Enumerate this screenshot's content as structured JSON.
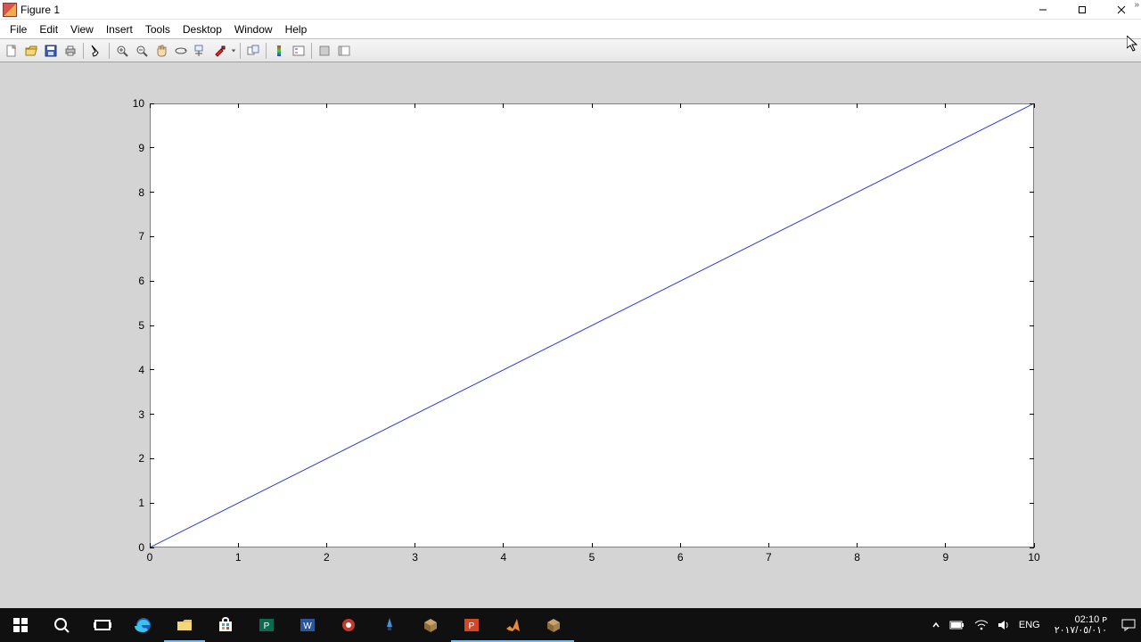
{
  "window": {
    "title": "Figure 1"
  },
  "menus": [
    "File",
    "Edit",
    "View",
    "Insert",
    "Tools",
    "Desktop",
    "Window",
    "Help"
  ],
  "chart_data": {
    "type": "line",
    "x": [
      0,
      1,
      2,
      3,
      4,
      5,
      6,
      7,
      8,
      9,
      10
    ],
    "y": [
      0,
      1,
      2,
      3,
      4,
      5,
      6,
      7,
      8,
      9,
      10
    ],
    "xlim": [
      0,
      10
    ],
    "ylim": [
      0,
      10
    ],
    "xticks": [
      0,
      1,
      2,
      3,
      4,
      5,
      6,
      7,
      8,
      9,
      10
    ],
    "yticks": [
      0,
      1,
      2,
      3,
      4,
      5,
      6,
      7,
      8,
      9,
      10
    ],
    "line_color": "#2e3bd1"
  },
  "tray": {
    "lang": "ENG",
    "time": "02:10 ᴘ",
    "date": "٢٠١٧/٠٥/٠١٠"
  }
}
